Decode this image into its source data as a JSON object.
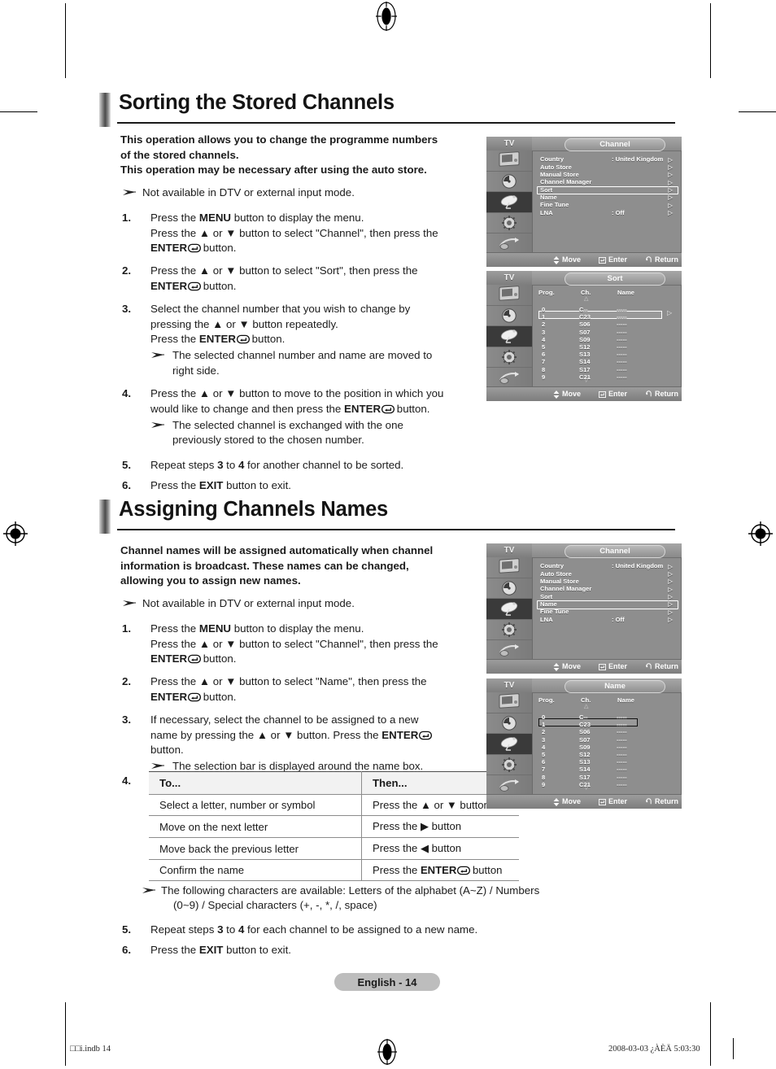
{
  "page": {
    "number_label": "English - 14",
    "footer_left": "□□i.indb  14",
    "footer_right": "2008-03-03   ¿ÀÈÄ 5:03:30"
  },
  "sections": [
    {
      "id": "sorting",
      "title": "Sorting the Stored Channels",
      "lead_line1": "This operation allows you to change the programme numbers",
      "lead_line2": "of the stored channels.",
      "lead_line3": "This operation may be necessary after using the auto store.",
      "note": "Not available in DTV or external input mode.",
      "steps": [
        {
          "num": "1.",
          "line1_a": "Press the ",
          "line1_b": "MENU",
          "line1_c": " button to display the menu.",
          "line2_a": "Press the ",
          "line2_b": " or ",
          "line2_c": " button to select \"Channel\", then press the",
          "line3_a": "ENTER",
          "line3_b": " button."
        },
        {
          "num": "2.",
          "line1_a": "Press the ",
          "line1_b": " or ",
          "line1_c": " button to select \"Sort\", then press the",
          "line2_a": "ENTER",
          "line2_b": " button."
        },
        {
          "num": "3.",
          "line1": "Select the channel number that you wish to change by",
          "line2": "pressing the ▲ or ▼ button repeatedly.",
          "line3_a": "Press the ",
          "line3_b": "ENTER",
          "line3_c": " button.",
          "sub1": "The selected channel number and name are moved to",
          "sub2": "right side."
        },
        {
          "num": "4.",
          "line1": "Press the ▲ or ▼ button to move to the position in which you",
          "line2_a": "would like to change and then press the ",
          "line2_b": "ENTER",
          "line2_c": " button.",
          "sub1": "The selected channel is exchanged with the one",
          "sub2": "previously stored to the chosen number."
        },
        {
          "num": "5.",
          "line1_a": "Repeat steps ",
          "line1_b": "3",
          "line1_c": " to ",
          "line1_d": "4",
          "line1_e": " for another channel to be sorted."
        },
        {
          "num": "6.",
          "line1_a": "Press the ",
          "line1_b": "EXIT",
          "line1_c": " button to exit."
        }
      ]
    },
    {
      "id": "naming",
      "title": "Assigning Channels Names",
      "lead_line1": "Channel names will be assigned automatically when channel",
      "lead_line2": "information is broadcast. These names can be changed,",
      "lead_line3": "allowing you to assign new names.",
      "note": "Not available in DTV or external input mode.",
      "steps": [
        {
          "num": "1.",
          "line1_a": "Press the ",
          "line1_b": "MENU",
          "line1_c": " button to display the menu.",
          "line2_c": " button to select \"Channel\", then press the",
          "line3_a": "ENTER",
          "line3_b": " button."
        },
        {
          "num": "2.",
          "line1_c": " button to select \"Name\", then press the",
          "line2_a": "ENTER",
          "line2_b": " button."
        },
        {
          "num": "3.",
          "line1": "If necessary, select the channel to be assigned to a new",
          "line2_a": "name by pressing the ▲ or ▼ button. Press the ",
          "line2_b": "ENTER",
          "line3": "button.",
          "sub1": "The selection bar is displayed around the name box."
        }
      ],
      "table_step_num": "4.",
      "table": {
        "headers": [
          "To...",
          "Then..."
        ],
        "rows": [
          {
            "to": "Select a letter, number or symbol",
            "then_pre": "Press the ▲ or ▼ button",
            "then_enter": false
          },
          {
            "to": "Move on the next letter",
            "then_pre": "Press the ▶ button",
            "then_enter": false
          },
          {
            "to": "Move back the previous letter",
            "then_pre": "Press the ◀ button",
            "then_enter": false
          },
          {
            "to": "Confirm the name",
            "then_pre": "Press the ",
            "then_bold": "ENTER",
            "then_post": " button",
            "then_enter": true
          }
        ]
      },
      "final_note_line1": "The following characters are available: Letters of the alphabet (A~Z) / Numbers",
      "final_note_line2": "(0~9) / Special characters (+, -, *, /, space)",
      "final_steps": [
        {
          "num": "5.",
          "line1_a": "Repeat steps ",
          "line1_b": "3",
          "line1_c": " to ",
          "line1_d": "4",
          "line1_e": " for each channel to be assigned to a new name."
        },
        {
          "num": "6.",
          "line1_a": "Press the ",
          "line1_b": "EXIT",
          "line1_c": " button to exit."
        }
      ]
    }
  ],
  "osd": {
    "device_label": "TV",
    "footer": {
      "move": "Move",
      "enter": "Enter",
      "return": "Return"
    },
    "icons": [
      "picture-icon",
      "sound-icon",
      "channel-dish-icon",
      "setup-gear-icon",
      "input-icon",
      "list-icon"
    ],
    "selected_icon_index": 2,
    "channel_menu": {
      "title": "Channel",
      "items": [
        {
          "label": "Country",
          "value": ": United Kingdom"
        },
        {
          "label": "Auto Store",
          "value": ""
        },
        {
          "label": "Manual Store",
          "value": ""
        },
        {
          "label": "Channel Manager",
          "value": ""
        },
        {
          "label": "Sort",
          "value": ""
        },
        {
          "label": "Name",
          "value": ""
        },
        {
          "label": "Fine Tune",
          "value": ""
        },
        {
          "label": "LNA",
          "value": ": Off"
        }
      ],
      "highlight_sort_index": 4,
      "highlight_name_index": 5
    },
    "sort_screen": {
      "title": "Sort",
      "columns": [
        "Prog.",
        "Ch.",
        "Name"
      ],
      "rows": [
        {
          "prog": "0",
          "ch": "C--",
          "name": "-----"
        },
        {
          "prog": "1",
          "ch": "C23",
          "name": "-----"
        },
        {
          "prog": "2",
          "ch": "S06",
          "name": "-----"
        },
        {
          "prog": "3",
          "ch": "S07",
          "name": "-----"
        },
        {
          "prog": "4",
          "ch": "S09",
          "name": "-----"
        },
        {
          "prog": "5",
          "ch": "S12",
          "name": "-----"
        },
        {
          "prog": "6",
          "ch": "S13",
          "name": "-----"
        },
        {
          "prog": "7",
          "ch": "S14",
          "name": "-----"
        },
        {
          "prog": "8",
          "ch": "S17",
          "name": "-----"
        },
        {
          "prog": "9",
          "ch": "C21",
          "name": "-----"
        }
      ],
      "selected_row_index": 1,
      "scroll_up": "△",
      "scroll_down": "▽"
    },
    "name_screen": {
      "title": "Name",
      "columns": [
        "Prog.",
        "Ch.",
        "Name"
      ],
      "rows": [
        {
          "prog": "0",
          "ch": "C--",
          "name": "-----"
        },
        {
          "prog": "1",
          "ch": "C23",
          "name": "-----"
        },
        {
          "prog": "2",
          "ch": "S06",
          "name": "-----"
        },
        {
          "prog": "3",
          "ch": "S07",
          "name": "-----"
        },
        {
          "prog": "4",
          "ch": "S09",
          "name": "-----"
        },
        {
          "prog": "5",
          "ch": "S12",
          "name": "-----"
        },
        {
          "prog": "6",
          "ch": "S13",
          "name": "-----"
        },
        {
          "prog": "7",
          "ch": "S14",
          "name": "-----"
        },
        {
          "prog": "8",
          "ch": "S17",
          "name": "-----"
        },
        {
          "prog": "9",
          "ch": "C21",
          "name": "-----"
        }
      ],
      "selected_row_index": 1,
      "scroll_up": "△",
      "scroll_down": "▽"
    }
  }
}
